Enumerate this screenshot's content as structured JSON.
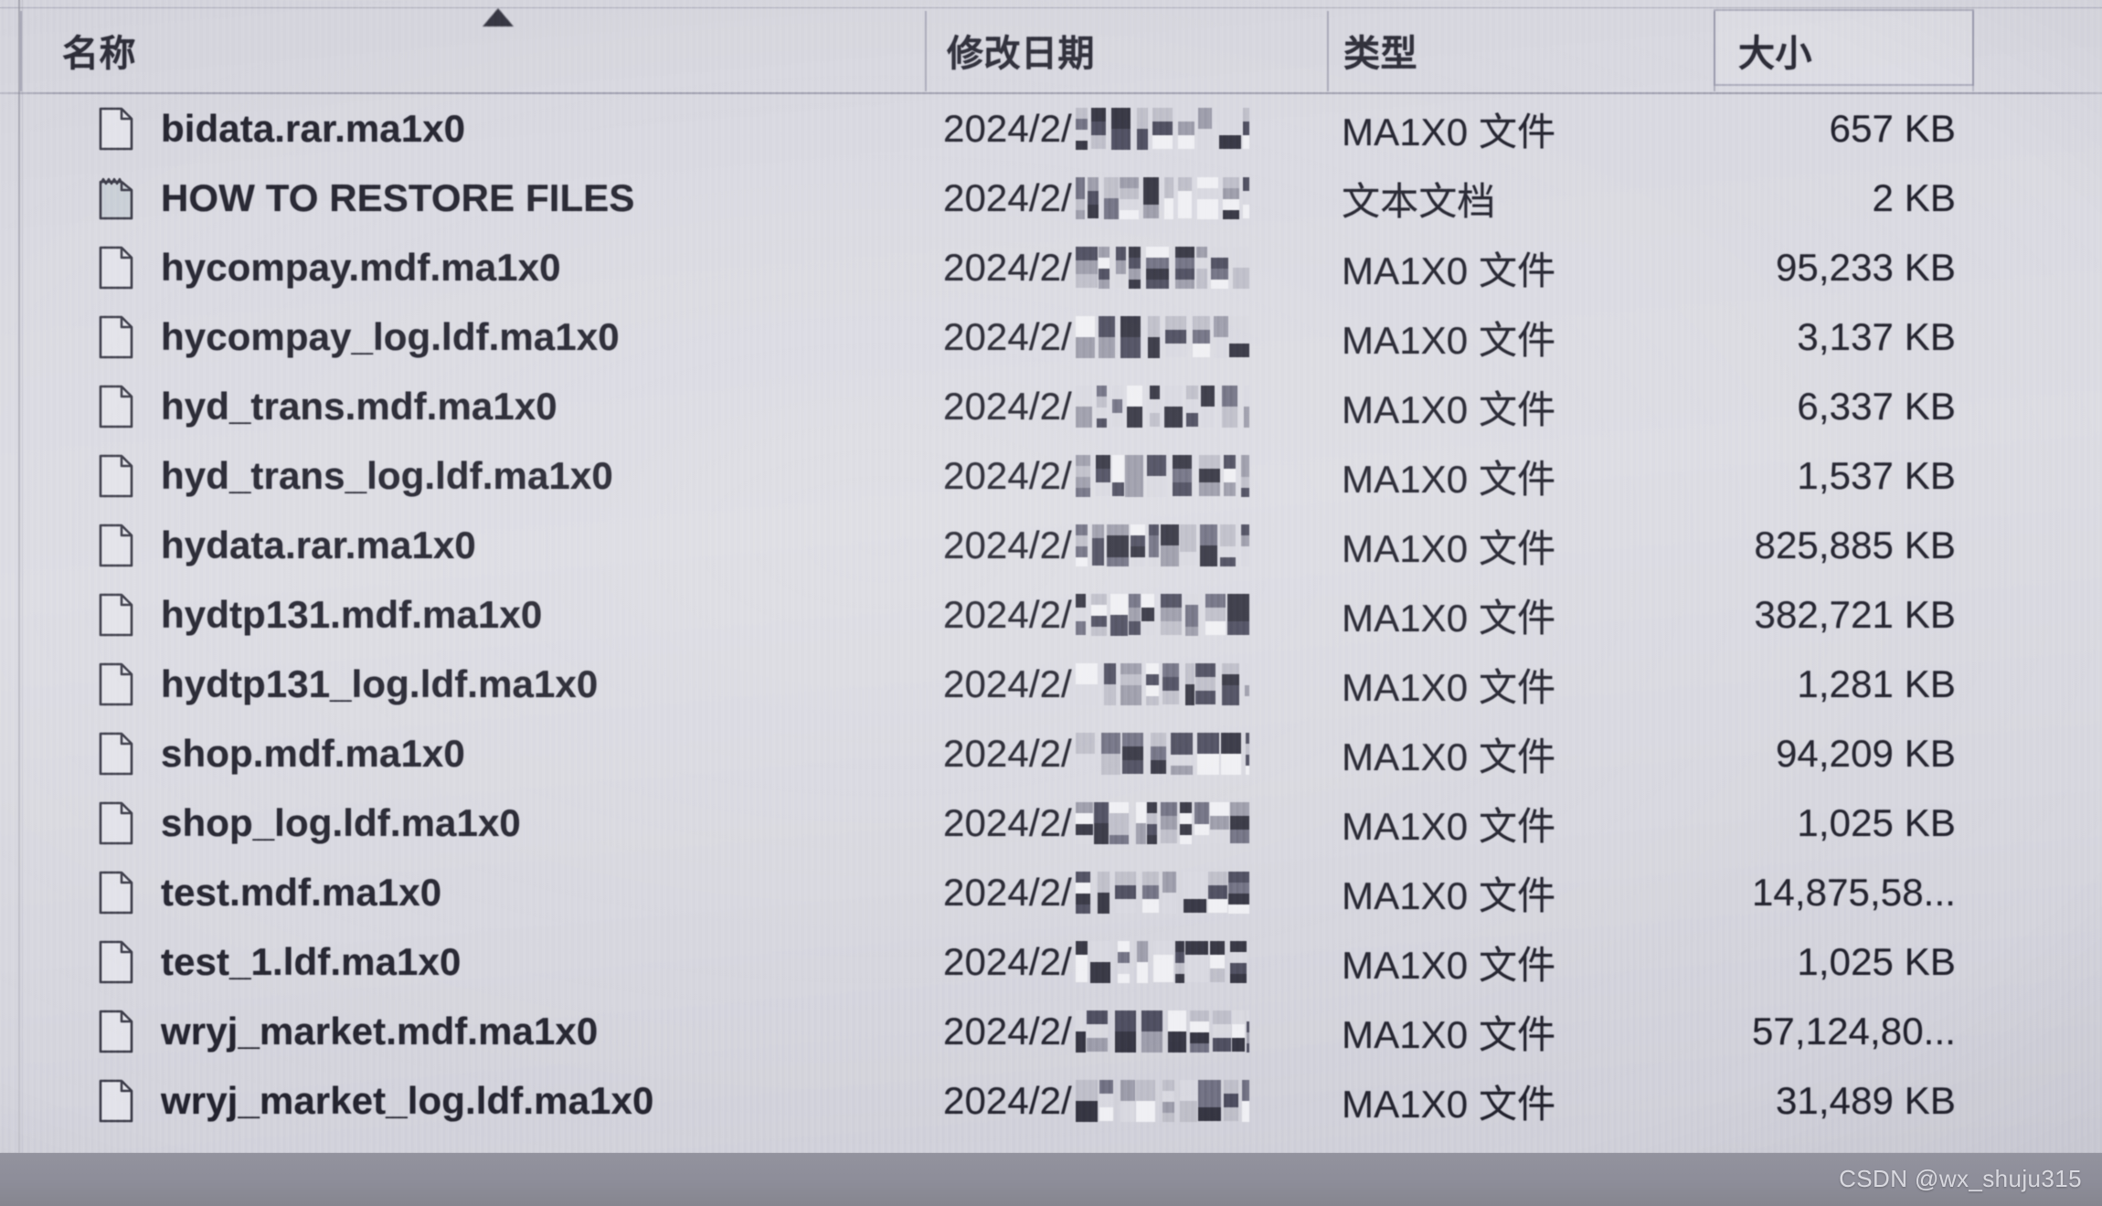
{
  "window": {
    "app": "Windows File Explorer",
    "view": "details"
  },
  "columns": {
    "name": "名称",
    "date_modified": "修改日期",
    "type": "类型",
    "size": "大小",
    "sort_column": "名称",
    "sort_direction": "ascending",
    "sort_arrow_icon": "sort-ascending-arrow",
    "hovered_column": "大小"
  },
  "types": {
    "ma1x0_file": "MA1X0 文件",
    "text_document": "文本文档"
  },
  "date_prefix": "2024/2/",
  "redaction": "mosaic",
  "rows": [
    {
      "icon": "file-icon",
      "name": "bidata.rar.ma1x0",
      "date": "2024/2/",
      "type": "MA1X0 文件",
      "size": "657 KB"
    },
    {
      "icon": "text-file-icon",
      "name": "HOW TO RESTORE FILES",
      "date": "2024/2/",
      "type": "文本文档",
      "size": "2 KB"
    },
    {
      "icon": "file-icon",
      "name": "hycompay.mdf.ma1x0",
      "date": "2024/2/",
      "type": "MA1X0 文件",
      "size": "95,233 KB"
    },
    {
      "icon": "file-icon",
      "name": "hycompay_log.ldf.ma1x0",
      "date": "2024/2/",
      "type": "MA1X0 文件",
      "size": "3,137 KB"
    },
    {
      "icon": "file-icon",
      "name": "hyd_trans.mdf.ma1x0",
      "date": "2024/2/",
      "type": "MA1X0 文件",
      "size": "6,337 KB"
    },
    {
      "icon": "file-icon",
      "name": "hyd_trans_log.ldf.ma1x0",
      "date": "2024/2/",
      "type": "MA1X0 文件",
      "size": "1,537 KB"
    },
    {
      "icon": "file-icon",
      "name": "hydata.rar.ma1x0",
      "date": "2024/2/",
      "type": "MA1X0 文件",
      "size": "825,885 KB"
    },
    {
      "icon": "file-icon",
      "name": "hydtp131.mdf.ma1x0",
      "date": "2024/2/",
      "type": "MA1X0 文件",
      "size": "382,721 KB"
    },
    {
      "icon": "file-icon",
      "name": "hydtp131_log.ldf.ma1x0",
      "date": "2024/2/",
      "type": "MA1X0 文件",
      "size": "1,281 KB"
    },
    {
      "icon": "file-icon",
      "name": "shop.mdf.ma1x0",
      "date": "2024/2/",
      "type": "MA1X0 文件",
      "size": "94,209 KB"
    },
    {
      "icon": "file-icon",
      "name": "shop_log.ldf.ma1x0",
      "date": "2024/2/",
      "type": "MA1X0 文件",
      "size": "1,025 KB"
    },
    {
      "icon": "file-icon",
      "name": "test.mdf.ma1x0",
      "date": "2024/2/",
      "type": "MA1X0 文件",
      "size": "14,875,58..."
    },
    {
      "icon": "file-icon",
      "name": "test_1.ldf.ma1x0",
      "date": "2024/2/",
      "type": "MA1X0 文件",
      "size": "1,025 KB"
    },
    {
      "icon": "file-icon",
      "name": "wryj_market.mdf.ma1x0",
      "date": "2024/2/",
      "type": "MA1X0 文件",
      "size": "57,124,80..."
    },
    {
      "icon": "file-icon",
      "name": "wryj_market_log.ldf.ma1x0",
      "date": "2024/2/",
      "type": "MA1X0 文件",
      "size": "31,489 KB"
    }
  ],
  "watermark": "CSDN @wx_shuju315",
  "colors": {
    "screen_bg": "#d8d8e0",
    "text": "#23232e",
    "header_text": "#2d2d38",
    "grid_line": "#7878941f",
    "bezel": "#8d8d99",
    "watermark_text": "#eeeef4"
  }
}
